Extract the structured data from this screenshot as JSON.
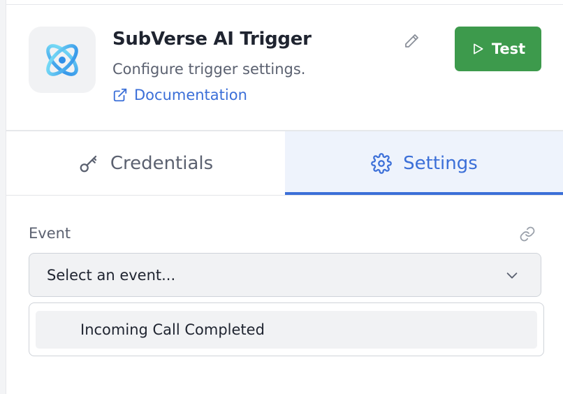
{
  "header": {
    "title": "SubVerse AI Trigger",
    "subtitle": "Configure trigger settings.",
    "documentation_label": "Documentation",
    "test_label": "Test",
    "icons": {
      "app": "subverse-orbit-logo",
      "edit": "pencil-icon",
      "external": "external-link-icon",
      "play": "play-icon"
    },
    "colors": {
      "test_button": "#3d9a4c",
      "link": "#3b6fd8"
    }
  },
  "tabs": [
    {
      "label": "Credentials",
      "icon": "key-icon",
      "active": false
    },
    {
      "label": "Settings",
      "icon": "gear-icon",
      "active": true
    }
  ],
  "event": {
    "label": "Event",
    "select_placeholder": "Select an event...",
    "options": [
      "Incoming Call Completed"
    ],
    "icons": {
      "link": "link-icon",
      "chevron": "chevron-down-icon"
    }
  }
}
